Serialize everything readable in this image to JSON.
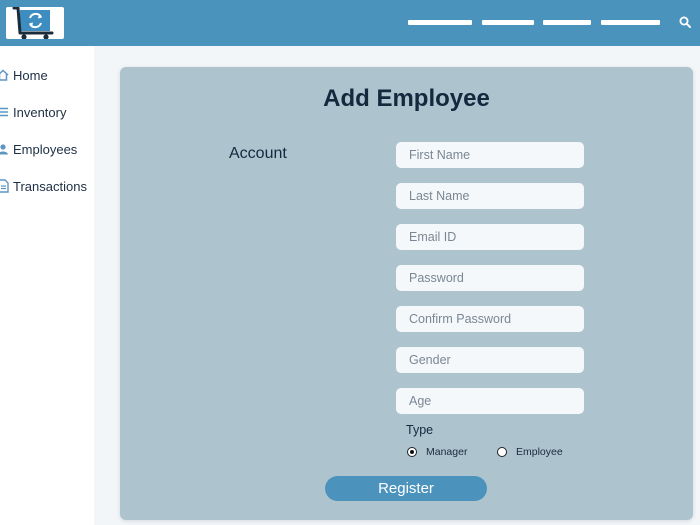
{
  "colors": {
    "topbar": "#4a93bd",
    "panel": "#adc4cf",
    "field": "#f4f8fb",
    "accent": "#4b93bd"
  },
  "header": {
    "logo_icon": "shopping-cart-refresh-icon",
    "nav_items": 4,
    "search_icon": "search-icon"
  },
  "sidebar": {
    "items": [
      {
        "label": "Home",
        "icon": "home-icon"
      },
      {
        "label": "Inventory",
        "icon": "list-icon"
      },
      {
        "label": "Employees",
        "icon": "user-icon"
      },
      {
        "label": "Transactions",
        "icon": "document-icon"
      }
    ]
  },
  "form": {
    "title": "Add Employee",
    "section_label": "Account",
    "fields": [
      {
        "placeholder": "First Name",
        "value": ""
      },
      {
        "placeholder": "Last Name",
        "value": ""
      },
      {
        "placeholder": "Email ID",
        "value": ""
      },
      {
        "placeholder": "Password",
        "value": ""
      },
      {
        "placeholder": "Confirm Password",
        "value": ""
      },
      {
        "placeholder": "Gender",
        "value": ""
      },
      {
        "placeholder": "Age",
        "value": ""
      }
    ],
    "type_label": "Type",
    "type_options": [
      {
        "label": "Manager",
        "selected": true
      },
      {
        "label": "Employee",
        "selected": false
      }
    ],
    "submit_label": "Register"
  }
}
